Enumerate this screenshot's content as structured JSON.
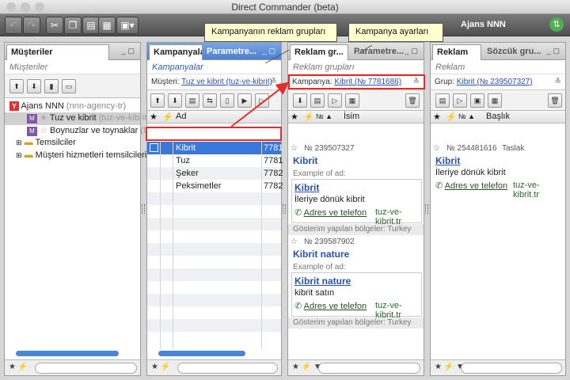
{
  "window": {
    "title": "Direct Commander (beta)"
  },
  "toolbar": {
    "agency": "Ajans NNN"
  },
  "panels": {
    "clients": {
      "tab": "Müşteriler",
      "subtitle": "Müşteriler",
      "tree": {
        "root": "Ajans NNN",
        "root_login": "(nnn-agency-tr)",
        "child1": "Tuz ve kibrit",
        "child1_login": "(tuz-ve-kibrit)",
        "child2": "Boynuzlar ve toynaklar",
        "child2_login": "(bo",
        "folder1": "Temsilciler",
        "folder2": "Müşteri hizmetleri temsilcileri"
      }
    },
    "campaigns": {
      "tab1": "Kampanyalar",
      "tab2": "Parametre...",
      "subtitle": "Kampanyalar",
      "filter_label": "Müşteri:",
      "filter_value": "Tuz ve kibrit (tuz-ve-kibrit)",
      "col_name": "Ad",
      "rows": [
        {
          "name": "Kibrit",
          "id": "7781"
        },
        {
          "name": "Tuz",
          "id": "7781"
        },
        {
          "name": "Şeker",
          "id": "7782"
        },
        {
          "name": "Peksimetler",
          "id": "7782"
        }
      ]
    },
    "groups": {
      "tab1": "Reklam gr...",
      "tab2": "Parametre...",
      "subtitle": "Reklam grupları",
      "filter_label": "Kampanya:",
      "filter_value": "Kibrit (№ 7781686)",
      "col_name": "İsim",
      "cards": [
        {
          "num": "№ 239507327",
          "name": "Kibrit",
          "example": "Example of ad:",
          "ad_title": "Kibrit",
          "ad_text": "İleriye dönük kibrit",
          "contact": "Adres ve telefon",
          "domain": "tuz-ve-kibrit.tr",
          "regions": "Gösterim yapılan bölgeler: Turkey"
        },
        {
          "num": "№ 239587902",
          "name": "Kibrit nature",
          "example": "Example of ad:",
          "ad_title": "Kibrit nature",
          "ad_text": "kibrit satın",
          "contact": "Adres ve telefon",
          "domain": "tuz-ve-kibrit.tr",
          "regions": "Gösterim yapılan bölgeler: Turkey"
        }
      ]
    },
    "ads": {
      "tab1": "Reklam",
      "tab2": "Sözcük gru...",
      "subtitle": "Reklam",
      "filter_label": "Grup:",
      "filter_value": "Kibrit (№ 239507327)",
      "col_name": "Başlık",
      "card": {
        "num": "№ 254481616",
        "status": "Taslak",
        "title": "Kibrit",
        "text": "İleriye dönük kibrit",
        "contact": "Adres ve telefon",
        "domain": "tuz-ve-kibrit.tr"
      }
    }
  },
  "callouts": {
    "groups": "Kampanyanın reklam grupları",
    "settings": "Kampanya ayarları"
  },
  "colors": {
    "accent": "#3a78d8",
    "highlight": "#e52b2b"
  }
}
